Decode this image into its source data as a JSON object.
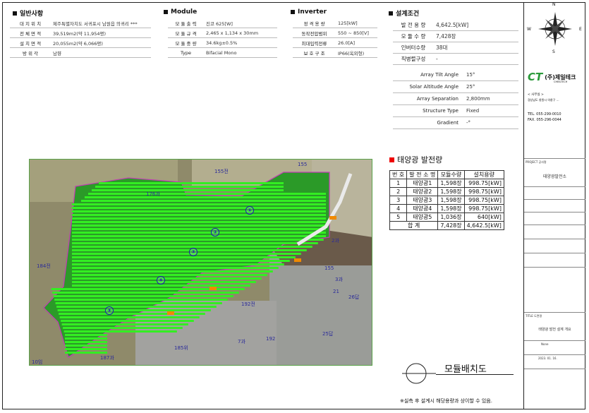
{
  "sections": {
    "general": "일반사항",
    "module": "Module",
    "inverter": "Inverter",
    "design": "설계조건"
  },
  "general_rows": [
    {
      "k": "대 지 위 치",
      "v": "제주특별자치도 서귀포시 남원읍 의귀리 ***"
    },
    {
      "k": "전 체 면 적",
      "v": "39,519m2(약 11,954평)"
    },
    {
      "k": "설 치 면 적",
      "v": "20,055m2(약 6,066평)"
    },
    {
      "k": "방 위 각",
      "v": "남향"
    }
  ],
  "module_rows": [
    {
      "k": "모 듈 출 력",
      "v": "진코 625[W]"
    },
    {
      "k": "모 듈 규 격",
      "v": "2,465 x 1,134 x 30mm"
    },
    {
      "k": "모 듈 중 량",
      "v": "34.6kg±0.5%"
    },
    {
      "k": "Type",
      "v": "Bifacial Mono"
    }
  ],
  "inverter_rows": [
    {
      "k": "정 격 용 량",
      "v": "125[kW]"
    },
    {
      "k": "동작전압범위",
      "v": "550 ~ 850[V]"
    },
    {
      "k": "최대입력전류",
      "v": "26.0[A]"
    },
    {
      "k": "보 호 구 조",
      "v": "IP66(옥외형)"
    }
  ],
  "design_rows": [
    {
      "k": "발 전 용 량",
      "v": "4,642.5[kW]"
    },
    {
      "k": "모 듈 수 량",
      "v": "7,428장"
    },
    {
      "k": "인버터수량",
      "v": "38대"
    },
    {
      "k": "직병렬구성",
      "v": "-"
    }
  ],
  "array_rows": [
    {
      "k": "Array Tilt Angle",
      "v": "15°"
    },
    {
      "k": "Solar Altitude Angle",
      "v": "25°"
    },
    {
      "k": "Array Separation",
      "v": "2,800mm"
    },
    {
      "k": "Structure Type",
      "v": "Fixed"
    },
    {
      "k": "Gradient",
      "v": "-°"
    }
  ],
  "generation": {
    "title": "태양광 발전량",
    "headers": [
      "번 호",
      "발 전 소 명",
      "모듈수량",
      "설치용량"
    ],
    "rows": [
      [
        "1",
        "태양광1",
        "1,598장",
        "998.75[kW]"
      ],
      [
        "2",
        "태양광2",
        "1,598장",
        "998.75[kW]"
      ],
      [
        "3",
        "태양광3",
        "1,598장",
        "998.75[kW]"
      ],
      [
        "4",
        "태양광4",
        "1,598장",
        "998.75[kW]"
      ],
      [
        "5",
        "태양광5",
        "1,036장",
        "640[kW]"
      ]
    ],
    "total_label": "합 계",
    "total_qty": "7,428장",
    "total_cap": "4,642.5[kW]"
  },
  "drawing_title": "모듈배치도",
  "footnote": "※실측 후 설계시 해당용량과 상이할 수 있음.",
  "map_labels": [
    "155전",
    "155",
    "176과",
    "184전",
    "155",
    "21",
    "26답",
    "192전",
    "192",
    "25답",
    "185위",
    "187과",
    "10임",
    "2과",
    "3과",
    "7과"
  ],
  "map_markers": [
    "①",
    "②",
    "③",
    "④",
    "⑤"
  ],
  "compass": {
    "n": "N",
    "s": "S",
    "e": "E",
    "w": "W"
  },
  "company": {
    "logo_text": "CT",
    "name": "(주)제일테크",
    "sub": "CHEILTECH",
    "address_label": "< 사무실 >",
    "address": "경상남도 창원시 의창구 …",
    "tel": "TEL. 055-299-0010",
    "fax": "FAX. 055-296-0044"
  },
  "title_block": {
    "project_label": "PROJECT 공사명",
    "project": "태양광발전소",
    "drawing_label": "TITLE 도면명",
    "drawing": "태양광 발전 설계 개요",
    "scale": "None",
    "date": "2023. 01. 16."
  }
}
